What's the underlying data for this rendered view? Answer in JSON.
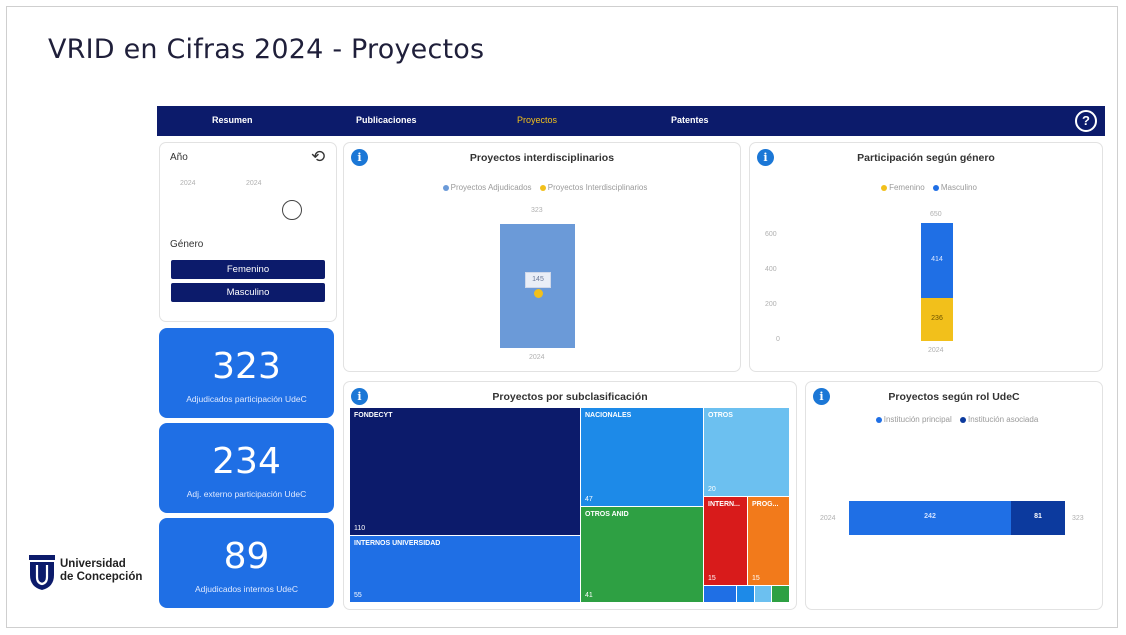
{
  "slide": {
    "title": "VRID en Cifras 2024 - Proyectos"
  },
  "nav": {
    "tabs": [
      "Resumen",
      "Publicaciones",
      "Proyectos",
      "Patentes"
    ],
    "active": "Proyectos",
    "help": "?"
  },
  "filters": {
    "year_label": "Año",
    "year_from": "2024",
    "year_to": "2024",
    "gender_label": "Género",
    "gender_options": [
      "Femenino",
      "Masculino"
    ]
  },
  "kpis": [
    {
      "value": "323",
      "label": "Adjudicados participación UdeC"
    },
    {
      "value": "234",
      "label": "Adj. externo participación UdeC"
    },
    {
      "value": "89",
      "label": "Adjudicados internos UdeC"
    }
  ],
  "interdisciplinary": {
    "title": "Proyectos interdisciplinarios",
    "legend": [
      "Proyectos Adjudicados",
      "Proyectos Interdisciplinarios"
    ],
    "top_label": "323",
    "point_label": "145",
    "x_label": "2024",
    "colors": {
      "bar": "#6b9ad8",
      "point": "#f2c01b"
    }
  },
  "gender_participation": {
    "title": "Participación según género",
    "legend": [
      "Femenino",
      "Masculino"
    ],
    "y_ticks": [
      "600",
      "400",
      "200",
      "0"
    ],
    "total_label": "650",
    "x_label": "2024",
    "colors": {
      "Femenino": "#f2c01b",
      "Masculino": "#1f6fe5"
    }
  },
  "subclassification": {
    "title": "Proyectos por subclasificación",
    "tiles": [
      {
        "name": "FONDECYT",
        "value": "110",
        "color": "#0c1b6b"
      },
      {
        "name": "INTERNOS UNIVERSIDAD",
        "value": "55",
        "color": "#1f6fe5"
      },
      {
        "name": "NACIONALES",
        "value": "47",
        "color": "#1d8ae8"
      },
      {
        "name": "OTROS ANID",
        "value": "41",
        "color": "#2ea043"
      },
      {
        "name": "OTROS",
        "value": "20",
        "color": "#6cc0f0"
      },
      {
        "name": "INTERN...",
        "value": "15",
        "color": "#d81b1b"
      },
      {
        "name": "PROG...",
        "value": "15",
        "color": "#f27a1b"
      }
    ]
  },
  "role_udec": {
    "title": "Proyectos según rol UdeC",
    "legend": [
      "Institución principal",
      "Institución asociada"
    ],
    "y_label": "2024",
    "principal": "242",
    "associated": "81",
    "total": "323",
    "colors": {
      "principal": "#1f6fe5",
      "associated": "#0c3a9e"
    }
  },
  "chart_data": [
    {
      "type": "bar",
      "title": "Proyectos interdisciplinarios",
      "categories": [
        "2024"
      ],
      "series": [
        {
          "name": "Proyectos Adjudicados",
          "values": [
            323
          ]
        },
        {
          "name": "Proyectos Interdisciplinarios",
          "values": [
            145
          ]
        }
      ]
    },
    {
      "type": "bar",
      "title": "Participación según género",
      "categories": [
        "2024"
      ],
      "series": [
        {
          "name": "Femenino",
          "values": [
            236
          ]
        },
        {
          "name": "Masculino",
          "values": [
            414
          ]
        }
      ],
      "ylim": [
        0,
        650
      ]
    },
    {
      "type": "bar",
      "title": "Proyectos según rol UdeC",
      "categories": [
        "2024"
      ],
      "series": [
        {
          "name": "Institución principal",
          "values": [
            242
          ]
        },
        {
          "name": "Institución asociada",
          "values": [
            81
          ]
        }
      ]
    }
  ],
  "logo": {
    "line1": "Universidad",
    "line2": "de Concepción"
  }
}
